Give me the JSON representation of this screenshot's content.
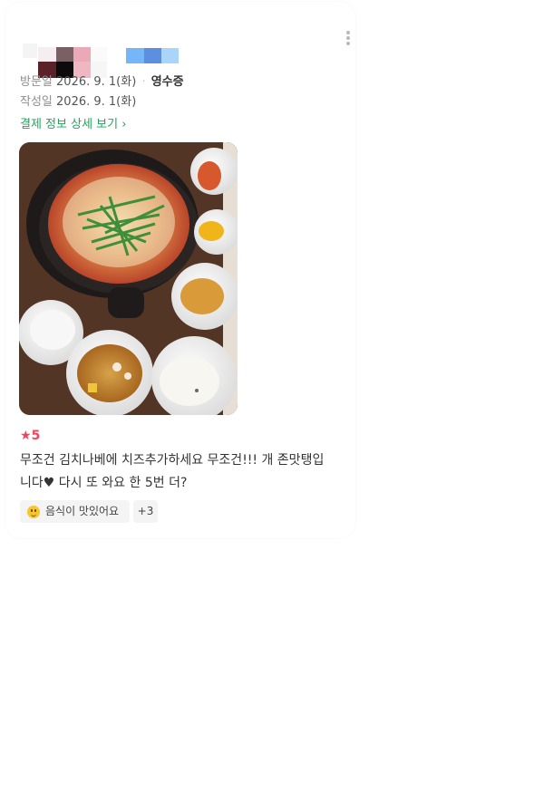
{
  "colors": {
    "accent_green": "#1ea55a",
    "rating_red": "#f0455c"
  },
  "visit": {
    "label": "방문일",
    "date": "2026. 9. 1(화)",
    "separator": "·",
    "receipt": "영수증"
  },
  "written": {
    "label": "작성일",
    "date": "2026. 9. 1(화)"
  },
  "payment_link": {
    "label": "결제 정보 상세 보기",
    "chevron": "›"
  },
  "photo": {
    "alt_icon": "food-photo"
  },
  "rating": {
    "star": "★",
    "value": "5"
  },
  "review": {
    "line1": "무조건 김치나베에 치즈추가하세요 무조건!!! 개 존맛탱입",
    "line2": "니다♥ 다시 또 와요 한 5번 더?"
  },
  "tags": {
    "food_label": "음식이 맛있어요",
    "food_icon": "smiley-icon",
    "more_label": "+3"
  },
  "more_menu_icon": "vertical-dots-icon"
}
